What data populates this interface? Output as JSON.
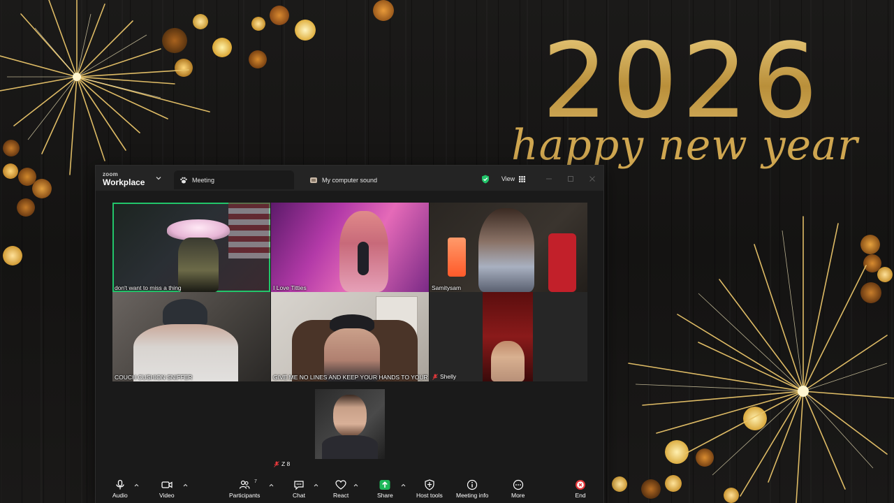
{
  "greeting": {
    "year": "2026",
    "script": "happy new year"
  },
  "titlebar": {
    "brand_top": "zoom",
    "brand_name": "Workplace",
    "tabs": [
      {
        "label": "Meeting"
      },
      {
        "label": "My computer sound"
      }
    ],
    "view_label": "View"
  },
  "participants": [
    {
      "name": "don't want to miss a thing",
      "active": true
    },
    {
      "name": "I Love Titties"
    },
    {
      "name": "Samitysam"
    },
    {
      "name": "COUCH CUSHION SNIFFER"
    },
    {
      "name": "GIVE ME NO LINES AND KEEP YOUR HANDS TO YOUR..."
    },
    {
      "name": "Shelly",
      "muted": true
    },
    {
      "name": "Z 8",
      "muted": true
    }
  ],
  "toolbar": {
    "audio": "Audio",
    "video": "Video",
    "participants": "Participants",
    "participants_count": "7",
    "chat": "Chat",
    "react": "React",
    "share": "Share",
    "host_tools": "Host tools",
    "meeting_info": "Meeting info",
    "more": "More",
    "end": "End"
  },
  "colors": {
    "active_speaker": "#22c56a",
    "share_green": "#1fb85a",
    "end_red": "#e5383b",
    "gold": "#c9a24a"
  }
}
